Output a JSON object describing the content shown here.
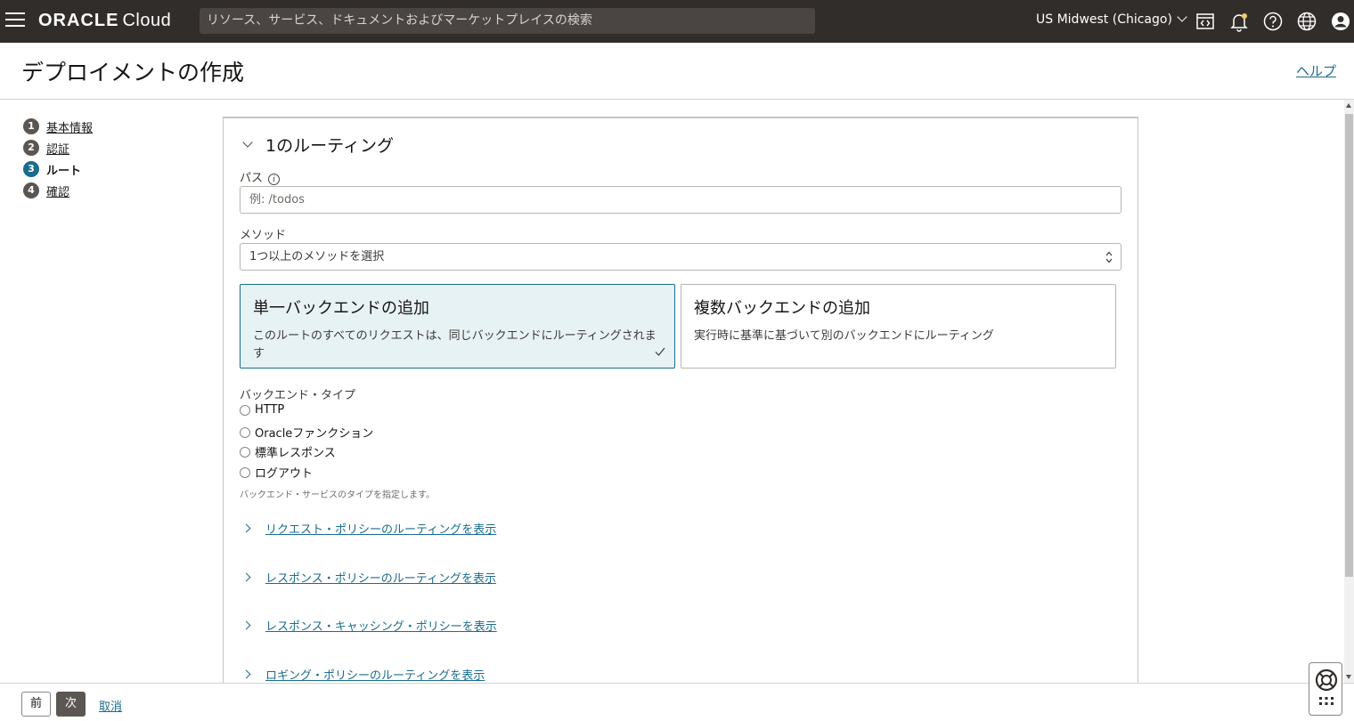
{
  "topbar": {
    "brand": "ORACLE",
    "cloud": "Cloud",
    "search_placeholder": "リソース、サービス、ドキュメントおよびマーケットプレイスの検索",
    "region": "US Midwest (Chicago)"
  },
  "header": {
    "title": "デプロイメントの作成",
    "help": "ヘルプ"
  },
  "steps": [
    {
      "num": "1",
      "label": "基本情報"
    },
    {
      "num": "2",
      "label": "認証"
    },
    {
      "num": "3",
      "label": "ルート"
    },
    {
      "num": "4",
      "label": "確認"
    }
  ],
  "route": {
    "section_title": "1のルーティング",
    "path_label": "パス",
    "path_placeholder": "例: /todos",
    "method_label": "メソッド",
    "method_placeholder": "1つ以上のメソッドを選択",
    "single_backend": {
      "title": "単一バックエンドの追加",
      "desc": "このルートのすべてのリクエストは、同じバックエンドにルーティングされます"
    },
    "multi_backend": {
      "title": "複数バックエンドの追加",
      "desc": "実行時に基準に基づいて別のバックエンドにルーティング"
    },
    "backend_type_label": "バックエンド・タイプ",
    "backend_types": [
      "HTTP",
      "Oracleファンクション",
      "標準レスポンス",
      "ログアウト"
    ],
    "backend_hint": "バックエンド・サービスのタイプを指定します。",
    "expanders": [
      "リクエスト・ポリシーのルーティングを表示",
      "レスポンス・ポリシーのルーティングを表示",
      "レスポンス・キャッシング・ポリシーを表示",
      "ロギング・ポリシーのルーティングを表示"
    ]
  },
  "footer": {
    "prev": "前",
    "next": "次",
    "cancel": "取消"
  }
}
